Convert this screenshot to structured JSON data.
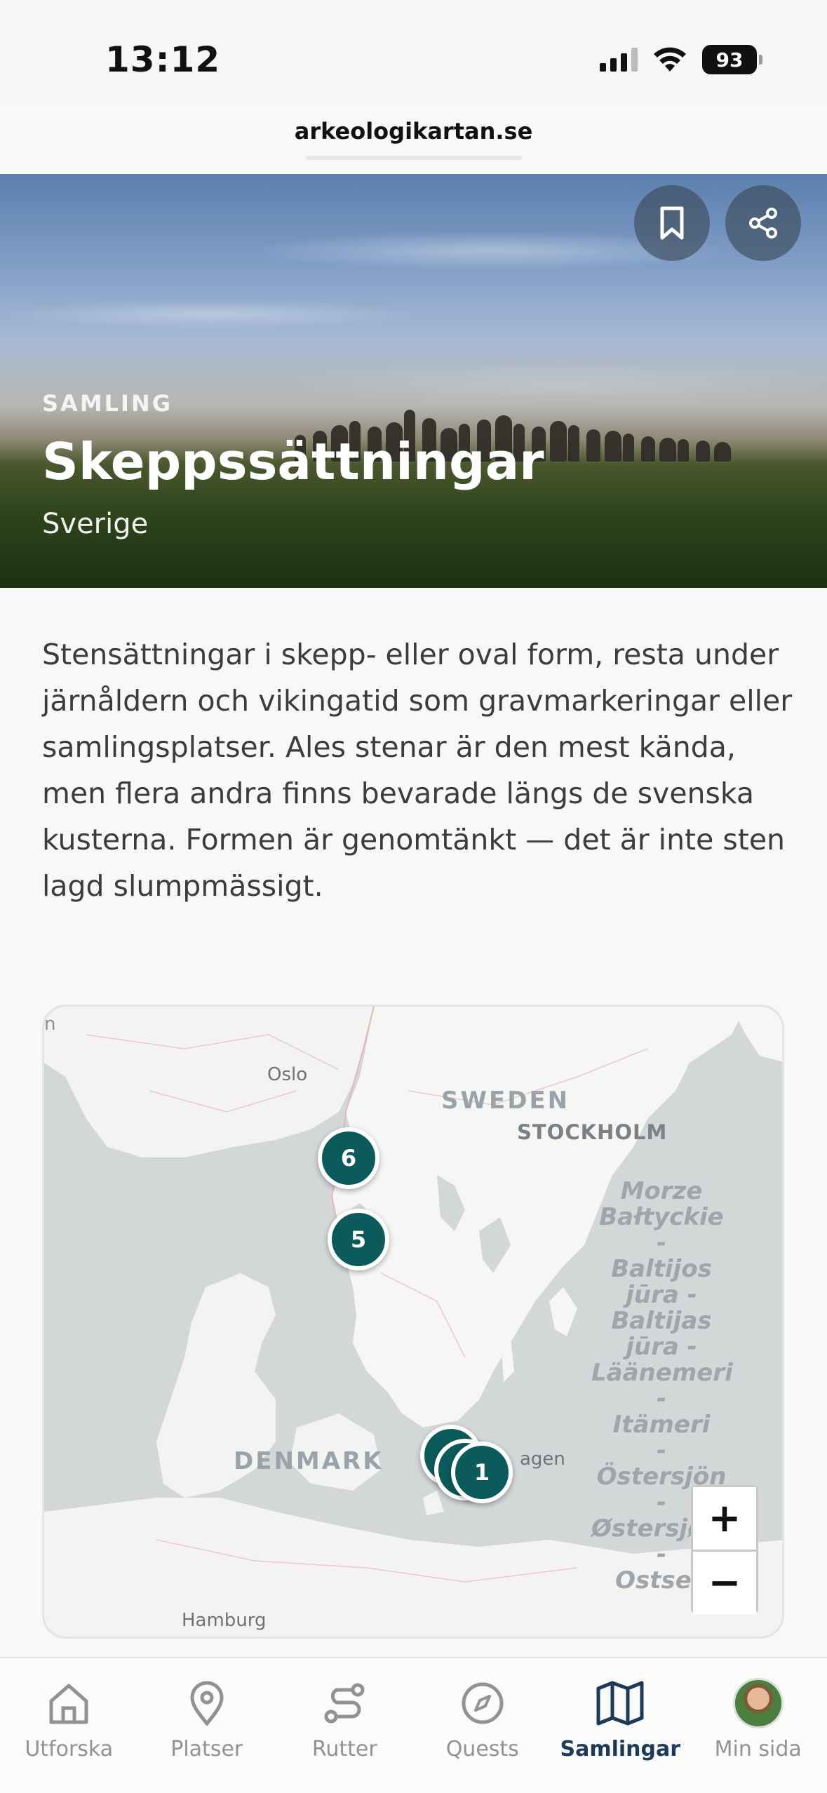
{
  "status_bar": {
    "time": "13:12",
    "battery": "93"
  },
  "browser": {
    "url": "arkeologikartan.se"
  },
  "hero": {
    "kicker": "SAMLING",
    "title": "Skeppssättningar",
    "subtitle": "Sverige",
    "bookmark_icon": "bookmark-icon",
    "share_icon": "share-icon"
  },
  "description": "Stensättningar i skepp- eller oval form, resta under järnåldern och vikingatid som gravmarkeringar eller samlingsplatser. Ales stenar är den mest kända, men flera andra finns bevarade längs de svenska kusterna. Formen är genomtänkt — det är inte sten lagd slumpmässigt.",
  "map": {
    "labels": {
      "oslo": "Oslo",
      "sweden": "SWEDEN",
      "stockholm": "STOCKHOLM",
      "denmark": "DENMARK",
      "copenhagen": "agen",
      "hamburg": "Hamburg",
      "edge_n": "n"
    },
    "sea_label": [
      "Morze",
      "Bałtyckie",
      "-",
      "Baltijos",
      "jūra -",
      "Baltijas",
      "jūra -",
      "Läänemeri",
      "-",
      "Itämeri",
      "-",
      "Östersjön",
      "-",
      "Østersjøen",
      "-",
      "Ostsee"
    ],
    "clusters": [
      {
        "label": "6"
      },
      {
        "label": "5"
      },
      {
        "label": ""
      },
      {
        "label": ""
      },
      {
        "label": "1"
      }
    ],
    "zoom_in": "+",
    "zoom_out": "−"
  },
  "nav": {
    "items": [
      {
        "label": "Utforska",
        "icon": "home-icon"
      },
      {
        "label": "Platser",
        "icon": "location-pin-icon"
      },
      {
        "label": "Rutter",
        "icon": "route-icon"
      },
      {
        "label": "Quests",
        "icon": "compass-icon"
      },
      {
        "label": "Samlingar",
        "icon": "map-icon",
        "active": true
      },
      {
        "label": "Min sida",
        "icon": "avatar"
      }
    ]
  },
  "colors": {
    "marker": "#0b5b5c",
    "active_nav": "#1e3a5a"
  }
}
